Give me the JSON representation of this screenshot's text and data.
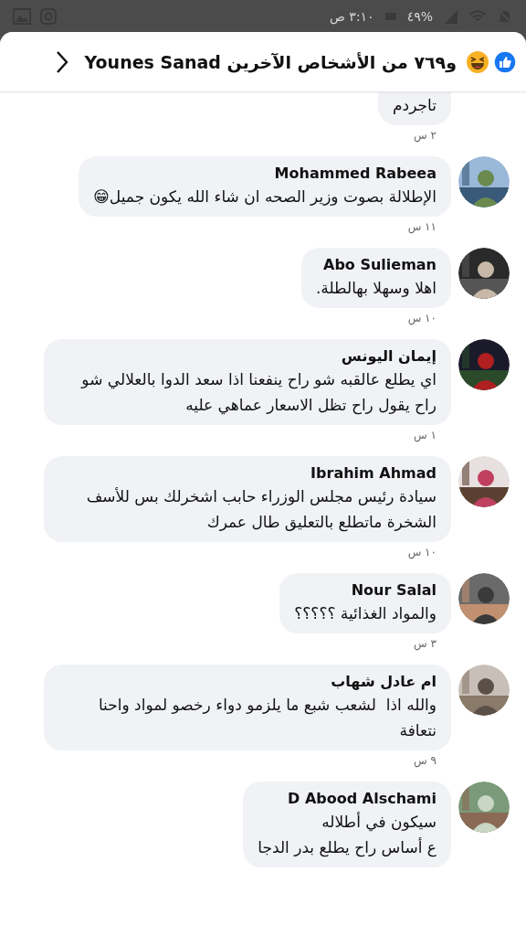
{
  "status_bar": {
    "time": "٣:١٠ ص",
    "battery": "%٤٩"
  },
  "header": {
    "title": "و٧٦٩ من الأشخاص الآخرين Younes Sanad"
  },
  "comments": [
    {
      "text": "تاجردم",
      "time": "٢ س",
      "partial": true
    },
    {
      "name": "Mohammed Rabeea",
      "text": "الإطلالة بصوت وزير الصحه ان شاء الله يكون جميل😁",
      "time": "١١ س"
    },
    {
      "name": "Abo Sulieman",
      "text": "اهلا وسهلا بهالطلة.",
      "time": "١٠ س"
    },
    {
      "name": "إيمان اليونس",
      "text": "اي يطلع عالقبه شو راح ينفعنا اذا سعد الدوا بالعلالي شو راح يقول راح تظل الاسعار عماهي عليه",
      "time": "١ س"
    },
    {
      "name": "Ibrahim Ahmad",
      "text": "سيادة رئيس مجلس الوزراء حابب اشخرلك بس للأسف الشخرة ماتطلع بالتعليق طال عمرك",
      "time": "١٠ س"
    },
    {
      "name": "Nour Salal",
      "text": "والمواد الغذائية ؟؟؟؟؟",
      "time": "٣ س"
    },
    {
      "name": "ام عادل شهاب",
      "text": "والله اذا  لشعب شبع ما يلزمو دواء رخصو لمواد واحنا نتعافة",
      "time": "٩ س"
    },
    {
      "name": "D Abood Alschami",
      "text": "سيكون في أطلاله\nع أساس راح يطلع بدر الدجا"
    }
  ]
}
